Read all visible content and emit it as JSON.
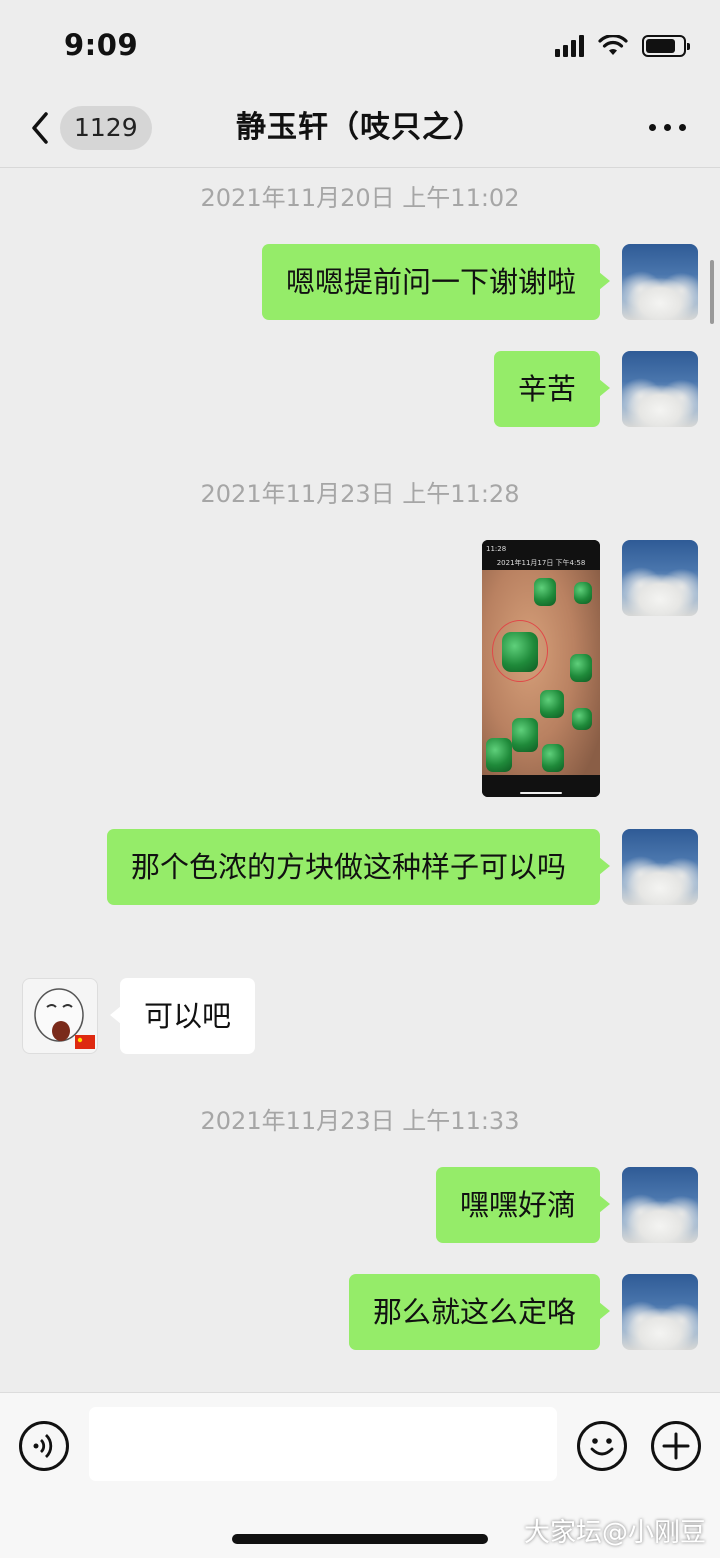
{
  "status_bar": {
    "time": "9:09"
  },
  "nav": {
    "back_count": "1129",
    "title": "静玉轩（吱只之）"
  },
  "messages": {
    "ts1": "2021年11月20日 上午11:02",
    "m1": "嗯嗯提前问一下谢谢啦",
    "m2": "辛苦",
    "ts2": "2021年11月23日 上午11:28",
    "img_header": "2021年11月17日 下午4:58",
    "img_time": "11:28",
    "m3": "那个色浓的方块做这种样子可以吗",
    "m4": "可以吧",
    "ts3": "2021年11月23日 上午11:33",
    "m5": "嘿嘿好滴",
    "m6": "那么就这么定咯"
  },
  "input": {
    "value": ""
  },
  "watermark": "大家坛@小刚豆",
  "colors": {
    "background": "#ededed",
    "outgoing_bubble": "#95ec69",
    "incoming_bubble": "#ffffff",
    "timestamp": "#a6a6a6"
  }
}
